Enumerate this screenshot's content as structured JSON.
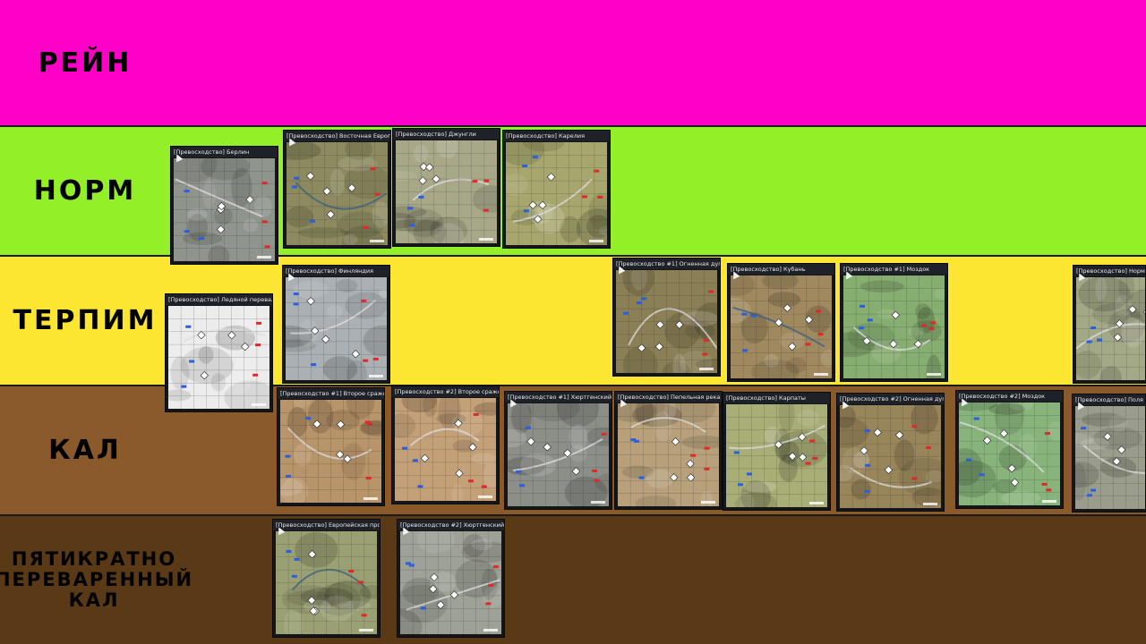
{
  "tiers": [
    {
      "label": "РЕЙН",
      "color": "#ff00c8",
      "maps": []
    },
    {
      "label": "НОРМ",
      "color": "#93f028",
      "maps": [
        {
          "title": "[Превосходство] Берлин",
          "terrain": "city"
        },
        {
          "title": "[Превосходство] Восточная Европа",
          "terrain": "river"
        },
        {
          "title": "[Превосходство] Джунгли",
          "terrain": "coast"
        },
        {
          "title": "[Превосходство] Карелия",
          "terrain": "forest"
        }
      ]
    },
    {
      "label": "ТЕРПИМ",
      "color": "#fde632",
      "maps": [
        {
          "title": "[Превосходство] Ледяной перевал",
          "terrain": "snow"
        },
        {
          "title": "[Превосходство] Финляндия",
          "terrain": "winter"
        },
        {
          "title": "[Превосходство #1] Огненная дуга",
          "terrain": "steppe"
        },
        {
          "title": "[Превосходство] Кубань",
          "terrain": "lake"
        },
        {
          "title": "[Превосходство #1] Моздок",
          "terrain": "green"
        },
        {
          "title": "[Превосходство] Нормандия",
          "terrain": "town"
        }
      ]
    },
    {
      "label": "КАЛ",
      "color": "#8b5a2b",
      "maps": [
        {
          "title": "[Превосходство #1] Второе сражение за Эль-",
          "terrain": "desert"
        },
        {
          "title": "[Превосходство #2] Второе сражение за Эль-",
          "terrain": "desert2"
        },
        {
          "title": "[Превосходство #1] Хюртгенский лес",
          "terrain": "forestgray"
        },
        {
          "title": "[Превосходство] Пепельная река",
          "terrain": "ash"
        },
        {
          "title": "[Превосходство] Карпаты",
          "terrain": "hills"
        },
        {
          "title": "[Превосходство #2] Огненная дуга",
          "terrain": "steppe2"
        },
        {
          "title": "[Превосходство #2] Моздок",
          "terrain": "green2"
        },
        {
          "title": "[Превосходство] Поля Норманд",
          "terrain": "fields"
        }
      ]
    },
    {
      "label": "ПЯТИКРАТНО ПЕРЕВАРЕННЫЙ КАЛ",
      "color": "#5a3a16",
      "maps": [
        {
          "title": "[Превосходство] Европейская провинция",
          "terrain": "province"
        },
        {
          "title": "[Превосходство #2] Хюртгенский лес",
          "terrain": "forestgray2"
        }
      ]
    }
  ],
  "terrain_colors": {
    "city": "#8f948c",
    "river": "#8c8a5e",
    "coast": "#a8a888",
    "forest": "#a6a66e",
    "snow": "#ececec",
    "winter": "#aab0b4",
    "steppe": "#8a7f55",
    "lake": "#a0895e",
    "green": "#86ae70",
    "town": "#a3a886",
    "desert": "#b8946a",
    "desert2": "#c4a078",
    "forestgray": "#8c8e88",
    "ash": "#b7a07a",
    "hills": "#a9ad76",
    "steppe2": "#98855a",
    "green2": "#88b47c",
    "fields": "#9a9c8c",
    "province": "#9aa072",
    "forestgray2": "#9ea196"
  }
}
